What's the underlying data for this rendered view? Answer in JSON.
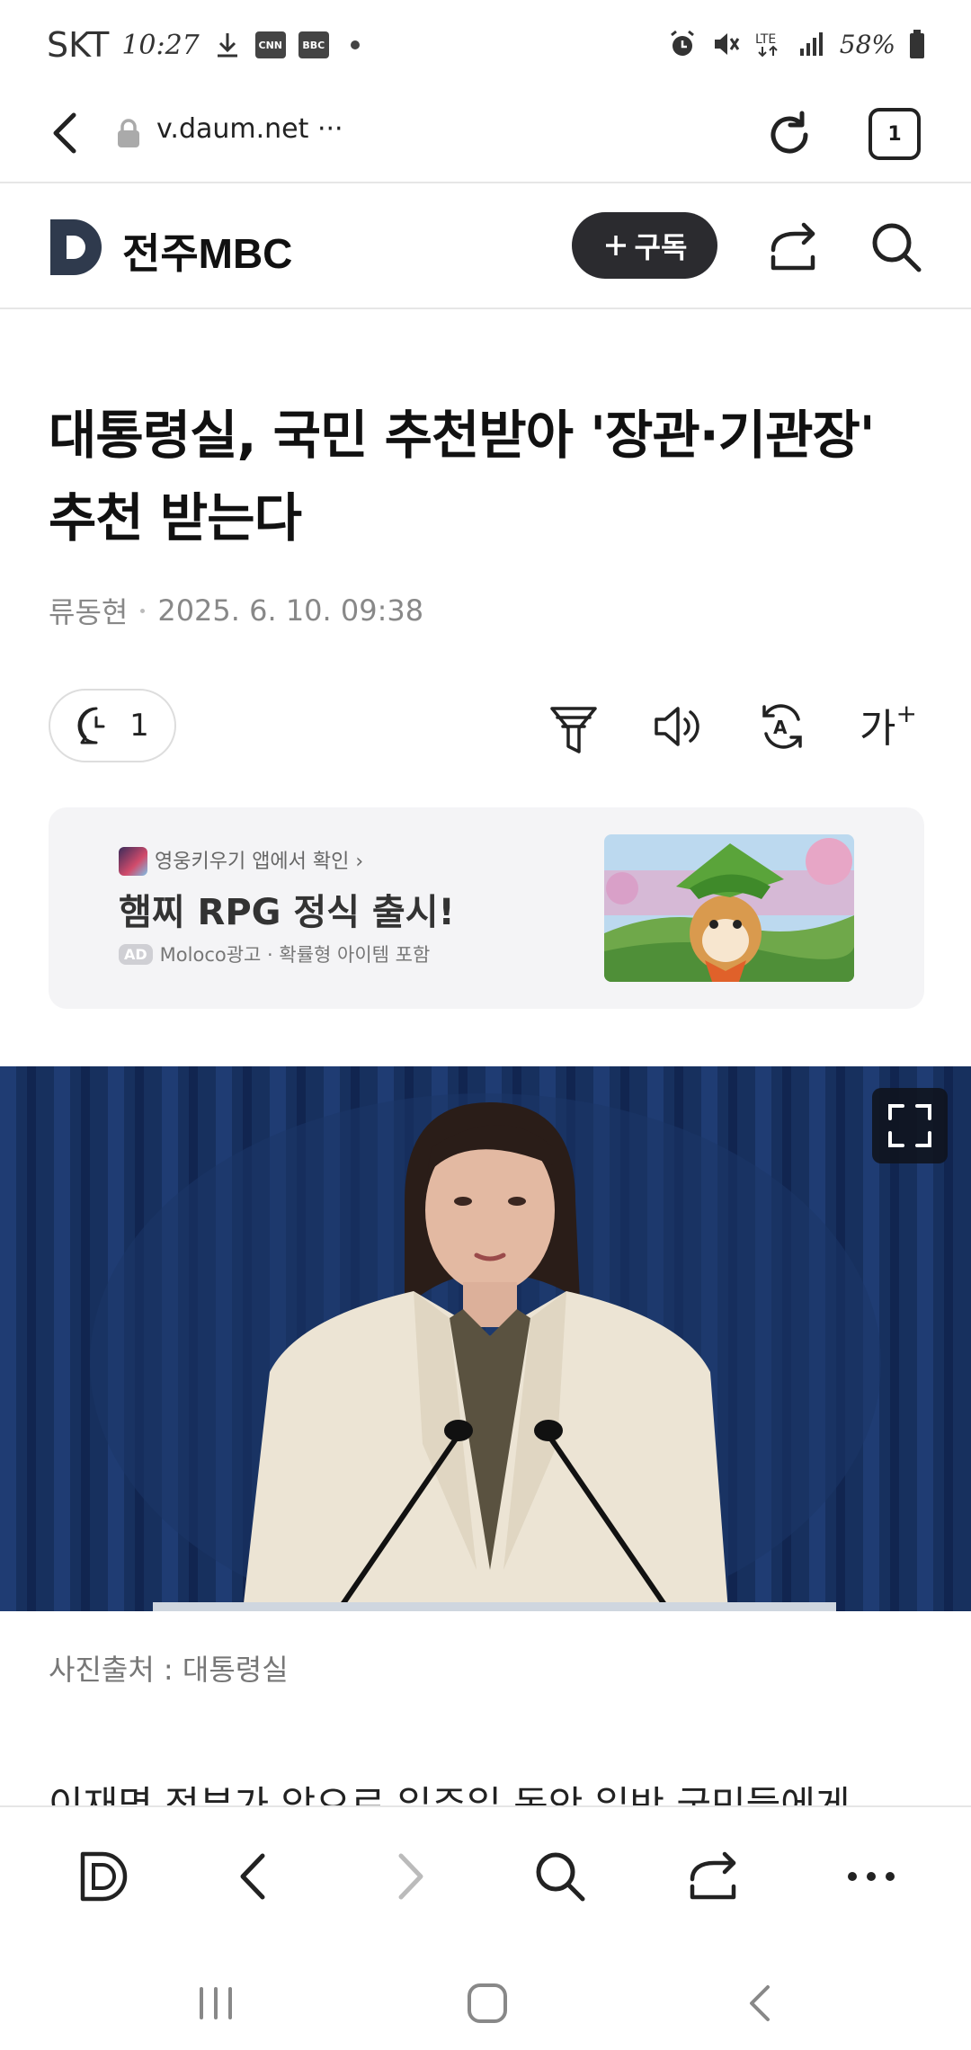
{
  "status_bar": {
    "carrier": "SKT",
    "time": "10:27",
    "battery": "58%",
    "network": "LTE"
  },
  "address_bar": {
    "url": "v.daum.net",
    "more": "···",
    "tab_count": "1"
  },
  "site_header": {
    "brand": "전주MBC",
    "subscribe_label": "구독"
  },
  "article": {
    "headline": "대통령실, 국민 추천받아 '장관·기관장' 추천 받는다",
    "author": "류동현",
    "datetime": "2025. 6. 10. 09:38",
    "comment_count": "1",
    "font_size_label": "가",
    "photo_caption": "사진출처 : 대통령실",
    "body_preview": "이재명 정부가 앞으로 일주일 동안 일반 국민들에게"
  },
  "ad": {
    "source": "영웅키우기 앱에서 확인",
    "title": "햄찌 RPG 정식 출시!",
    "badge": "AD",
    "meta": "Moloco광고 · 확률형 아이템 포함"
  },
  "icons": {
    "status": [
      "download-icon",
      "cnn-icon",
      "bbc-icon",
      "alarm-icon",
      "mute-icon",
      "signal-icon",
      "battery-icon"
    ],
    "toolbar": [
      "filter-icon",
      "speaker-icon",
      "translate-icon",
      "font-size-icon"
    ],
    "bottom": [
      "daum-icon",
      "back-icon",
      "forward-icon",
      "search-icon",
      "share-icon",
      "more-icon"
    ],
    "nav": [
      "recents-icon",
      "home-icon",
      "back-icon"
    ]
  }
}
